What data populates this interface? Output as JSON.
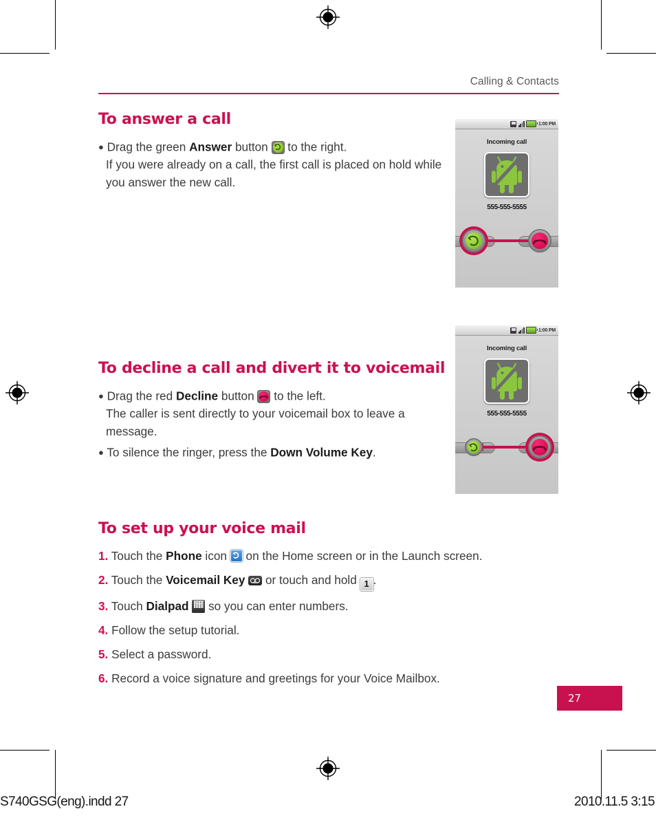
{
  "document": {
    "running_head": "Calling & Contacts",
    "page_number": "27",
    "footer_left": "S740GSG(eng).indd   27",
    "footer_right": "2010.11.5   3:15",
    "accent_color": "#c8114f",
    "heading_color": "#cc0f50"
  },
  "sections": [
    {
      "title": "To answer a call",
      "bullets": [
        {
          "lead": "Drag the green ",
          "bold": "Answer",
          "mid": " button ",
          "icon": "answer-button-icon",
          "tail": " to the right.",
          "continuation": "If you were already on a call, the first call is placed on hold while you answer the new call."
        }
      ]
    },
    {
      "title": "To decline a call and divert it to voicemail",
      "bullets": [
        {
          "lead": "Drag the red ",
          "bold": "Decline",
          "mid": " button ",
          "icon": "decline-button-icon",
          "tail": " to the left.",
          "continuation": "The caller is sent directly to your voicemail box to leave a message."
        },
        {
          "lead": "To silence the ringer, press the ",
          "bold": "Down Volume Key",
          "mid": "",
          "icon": null,
          "tail": ".",
          "continuation": ""
        }
      ]
    },
    {
      "title": "To set up your voice mail",
      "steps": [
        {
          "num": "1.",
          "pre": " Touch the ",
          "bold": "Phone",
          "mid": " icon ",
          "icon": "phone-icon",
          "post": " on the Home screen or in the Launch screen.",
          "bold2": "",
          "icon2": null,
          "post2": ""
        },
        {
          "num": "2.",
          "pre": " Touch the ",
          "bold": "Voicemail Key",
          "mid": " ",
          "icon": "voicemail-key-icon",
          "post": " or touch and hold ",
          "bold2": "",
          "icon2": "one-key-icon",
          "post2": "."
        },
        {
          "num": "3.",
          "pre": " Touch ",
          "bold": "Dialpad",
          "mid": " ",
          "icon": "dialpad-icon",
          "post": " so you can enter numbers.",
          "bold2": "",
          "icon2": null,
          "post2": ""
        },
        {
          "num": "4.",
          "pre": " Follow the setup tutorial.",
          "bold": "",
          "mid": "",
          "icon": null,
          "post": "",
          "bold2": "",
          "icon2": null,
          "post2": ""
        },
        {
          "num": "5.",
          "pre": " Select a password.",
          "bold": "",
          "mid": "",
          "icon": null,
          "post": "",
          "bold2": "",
          "icon2": null,
          "post2": ""
        },
        {
          "num": "6.",
          "pre": " Record a voice signature and greetings for your Voice Mailbox.",
          "bold": "",
          "mid": "",
          "icon": null,
          "post": "",
          "bold2": "",
          "icon2": null,
          "post2": ""
        }
      ]
    }
  ],
  "screenshots": [
    {
      "name": "answer-call-screenshot",
      "status_time": "1:00 PM",
      "title": "Incoming call",
      "caller": "555-555-5555",
      "highlight": "answer",
      "drag_direction": "right"
    },
    {
      "name": "decline-call-screenshot",
      "status_time": "1:00 PM",
      "title": "Incoming call",
      "caller": "555-555-5555",
      "highlight": "decline",
      "drag_direction": "left"
    }
  ],
  "inline_icon_labels": {
    "one_key": "1",
    "dialpad_caption": "Dialpad"
  }
}
